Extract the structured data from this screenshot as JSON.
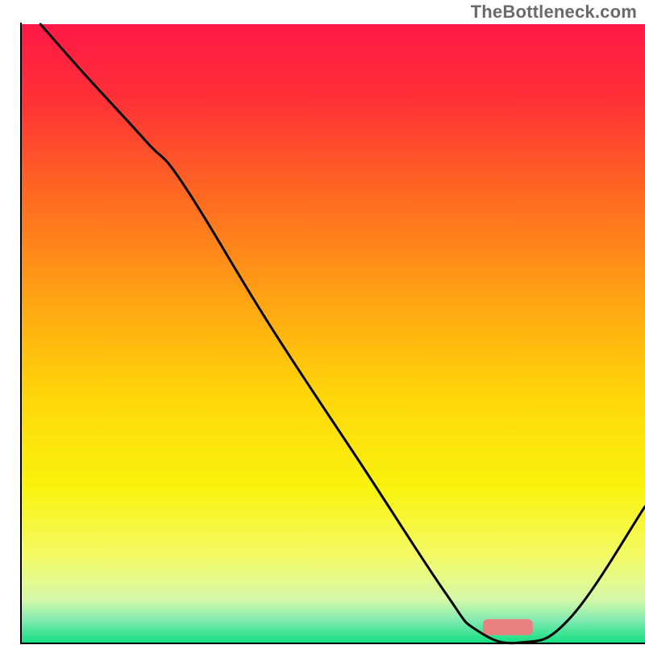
{
  "watermark": "TheBottleneck.com",
  "chart_data": {
    "type": "line",
    "title": "",
    "xlabel": "",
    "ylabel": "",
    "xlim": [
      0,
      100
    ],
    "ylim": [
      0,
      100
    ],
    "grid": false,
    "legend": false,
    "background_gradient": {
      "stops": [
        {
          "offset": 0.0,
          "color": "#ff1846"
        },
        {
          "offset": 0.12,
          "color": "#ff3037"
        },
        {
          "offset": 0.28,
          "color": "#ff6a22"
        },
        {
          "offset": 0.45,
          "color": "#ffa513"
        },
        {
          "offset": 0.6,
          "color": "#ffd60a"
        },
        {
          "offset": 0.75,
          "color": "#f9f30e"
        },
        {
          "offset": 0.86,
          "color": "#f4fb67"
        },
        {
          "offset": 0.93,
          "color": "#d6f9a8"
        },
        {
          "offset": 0.965,
          "color": "#7eeab0"
        },
        {
          "offset": 1.0,
          "color": "#14df82"
        }
      ]
    },
    "series": [
      {
        "name": "bottleneck-curve",
        "x": [
          3,
          10,
          20,
          26,
          40,
          55,
          68,
          73,
          80,
          88,
          100
        ],
        "y": [
          100,
          92,
          81,
          74,
          51,
          28,
          8,
          2,
          0,
          4,
          22
        ]
      }
    ],
    "marker": {
      "name": "optimal-zone",
      "x_start": 74,
      "x_end": 82,
      "y": 1.2,
      "height": 2.6
    }
  }
}
